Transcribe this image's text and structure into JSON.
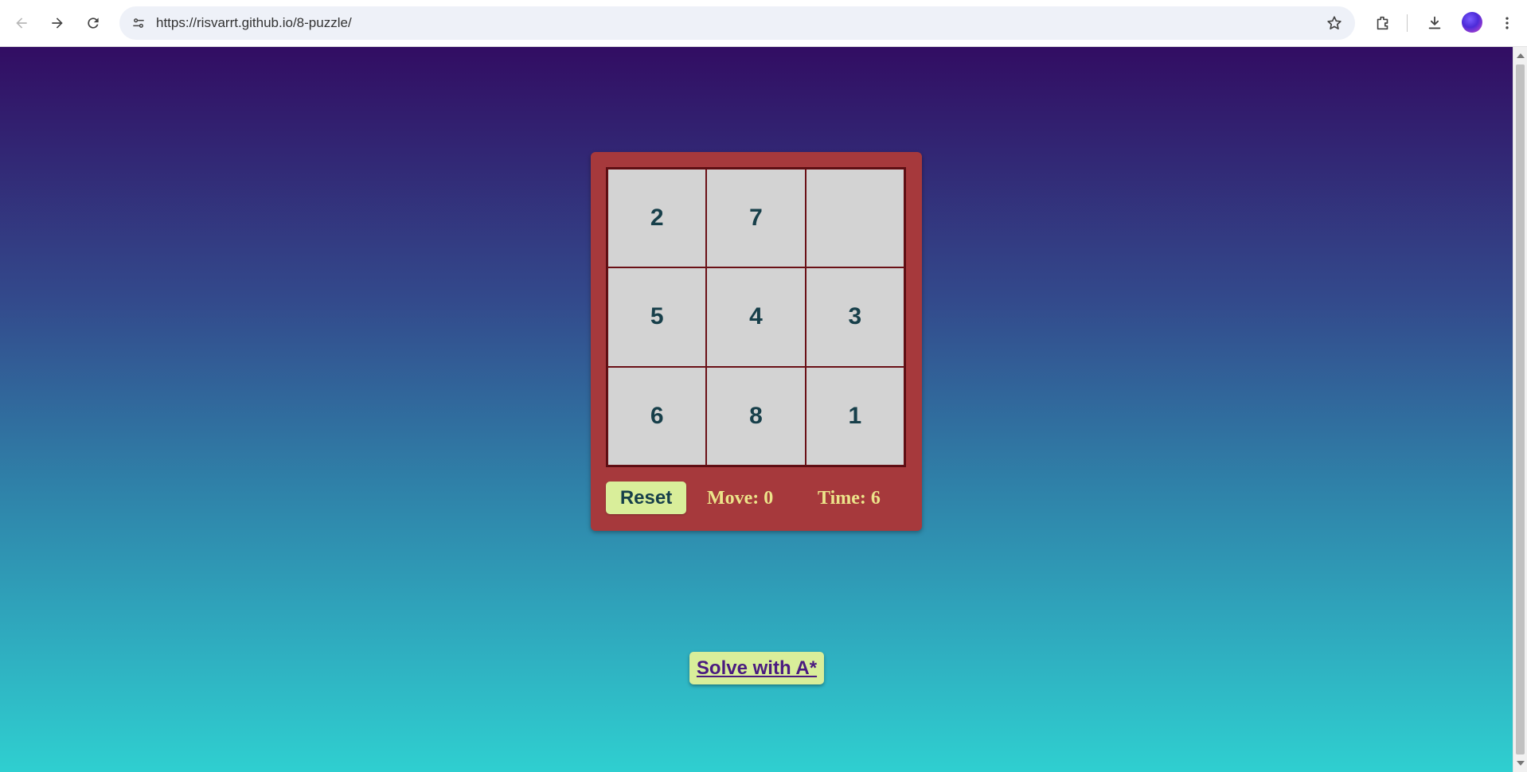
{
  "browser": {
    "url": "https://risvarrt.github.io/8-puzzle/"
  },
  "puzzle": {
    "tiles": [
      "2",
      "7",
      "",
      "5",
      "4",
      "3",
      "6",
      "8",
      "1"
    ],
    "reset_label": "Reset",
    "moves_text": "Move: 0",
    "time_text": "Time: 6"
  },
  "solve": {
    "label": "Solve with A*"
  },
  "colors": {
    "board_frame": "#a6393c",
    "tile_bg": "#d3d3d3",
    "tile_text": "#173f4a",
    "button_bg": "#d9ee9a",
    "stat_text": "#ece48a",
    "solve_text": "#4a1a80"
  },
  "icons": [
    "back-arrow-icon",
    "forward-arrow-icon",
    "reload-icon",
    "site-info-icon",
    "bookmark-star-icon",
    "extensions-icon",
    "download-icon",
    "profile-avatar",
    "menu-kebab-icon"
  ]
}
